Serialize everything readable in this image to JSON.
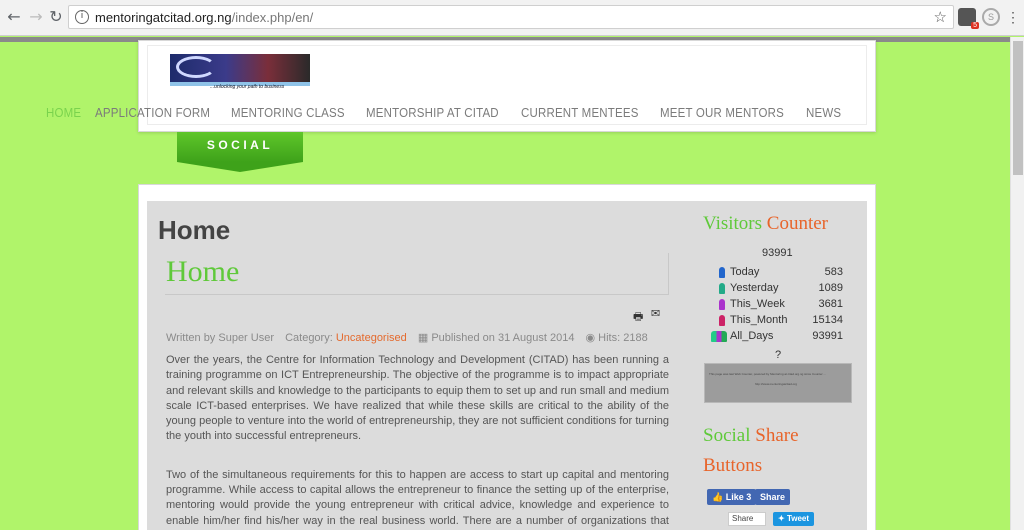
{
  "browser": {
    "url_domain": "mentoringatcitad.org.ng",
    "url_path": "/index.php/en/",
    "back_icon": "arrow-left",
    "forward_icon": "arrow-right",
    "reload_icon": "reload",
    "ext_badge": "5"
  },
  "site": {
    "logo_tagline": "...unlocking your path to business",
    "nav": [
      "HOME",
      "APPLICATION FORM",
      "MENTORING CLASS",
      "MENTORSHIP AT CITAD",
      "CURRENT MENTEES",
      "MEET OUR MENTORS",
      "NEWS"
    ],
    "active_nav": "HOME",
    "social_tab": "SOCIAL"
  },
  "article": {
    "page_title": "Home",
    "title": "Home",
    "meta": {
      "author": "Written by Super User",
      "category_label": "Category:",
      "category": "Uncategorised",
      "published": "Published on 31 August 2014",
      "hits": "Hits: 2188"
    },
    "paragraphs": [
      "Over the years, the Centre for Information Technology and Development (CITAD) has been running a training programme on ICT Entrepreneurship. The objective of the programme is to impact appropriate and relevant skills and knowledge to the participants to equip them to set up and run small and medium scale ICT-based enterprises. We have realized that while these skills are critical to the ability of the young people to venture into the world of entrepreneurship, they are not sufficient conditions for turning the youth into successful entrepreneurs.",
      "Two of the simultaneous requirements for this to happen are access to start up capital and mentoring programme. While access to capital allows the entrepreneur to finance the setting up of the enterprise, mentoring would provide the young entrepreneur with critical advice, knowledge and experience to enable him/her find his/her way in the real business world. There are a number of organizations that provide"
    ]
  },
  "sidebar": {
    "visitors_heading_1": "Visitors",
    "visitors_heading_2": "Counter",
    "total": "93991",
    "rows": [
      {
        "label": "Today",
        "value": "583",
        "color": "#2266cc"
      },
      {
        "label": "Yesterday",
        "value": "1089",
        "color": "#22aa88"
      },
      {
        "label": "This_Week",
        "value": "3681",
        "color": "#aa33cc"
      },
      {
        "label": "This_Month",
        "value": "15134",
        "color": "#cc2266"
      },
      {
        "label": "All_Days",
        "value": "93991",
        "color": "group"
      }
    ],
    "question": "?",
    "counter_image_line1": "This page was last Web Counter, powered by Mentoring at citad.org.ng since Counter ...",
    "counter_image_line2": "http://www.mentoringatcitad.org",
    "social_heading_1": "Social",
    "social_heading_2": "Share",
    "social_heading_3": "Buttons",
    "fb_like": "Like 3",
    "fb_share": "Share",
    "share_label": "Share",
    "tweet": "Tweet"
  }
}
